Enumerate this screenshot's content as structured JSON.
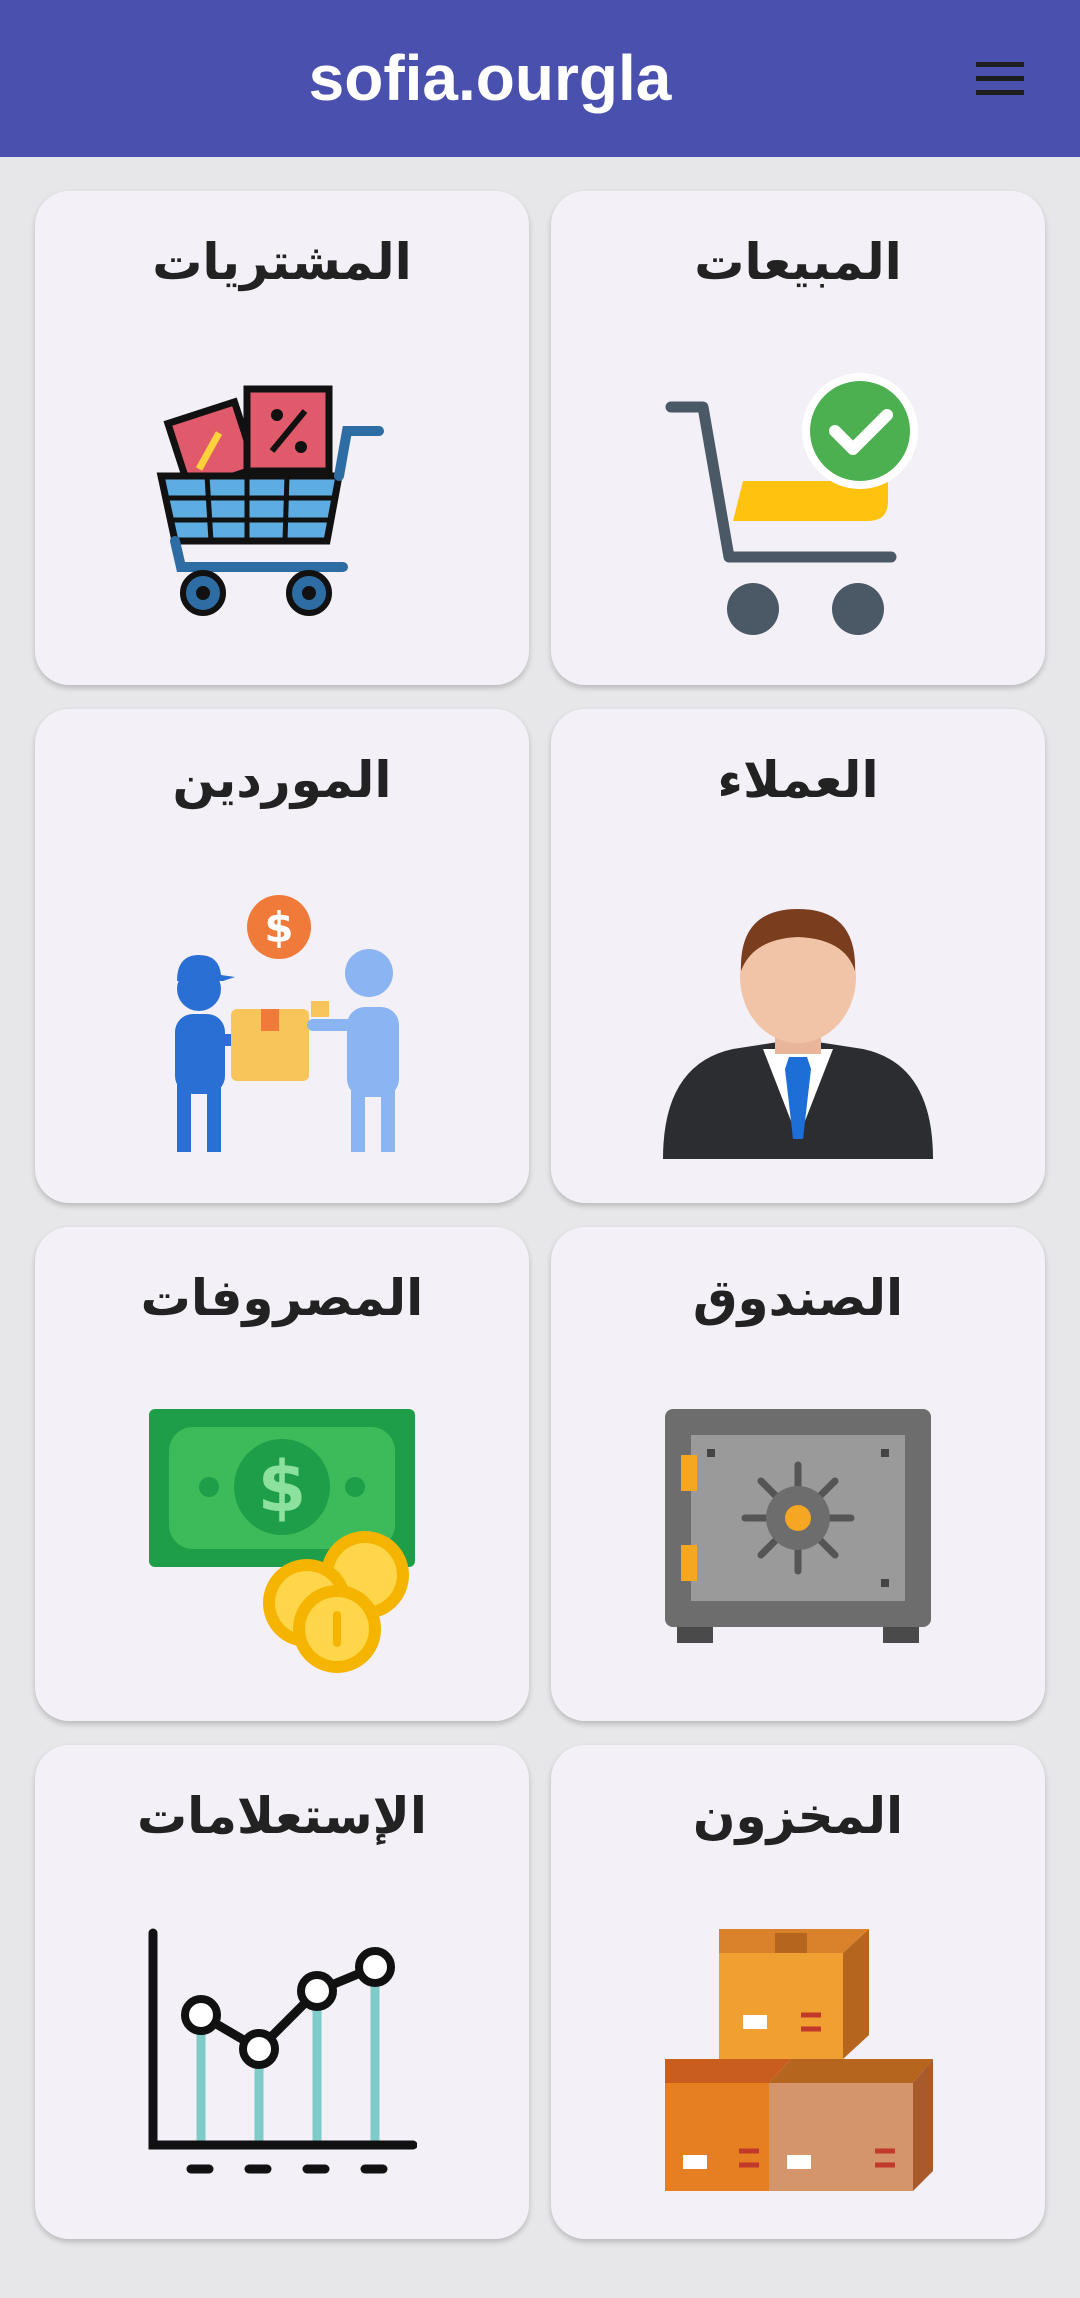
{
  "app": {
    "title": "sofia.ourgla",
    "menu_icon": "hamburger-menu-icon",
    "header_color": "#4a50ad"
  },
  "tiles": [
    {
      "id": "sales",
      "label": "المبيعات",
      "icon": "cart-check-icon"
    },
    {
      "id": "purchases",
      "label": "المشتريات",
      "icon": "shopping-cart-icon"
    },
    {
      "id": "customers",
      "label": "العملاء",
      "icon": "businessman-icon"
    },
    {
      "id": "suppliers",
      "label": "الموردين",
      "icon": "delivery-icon"
    },
    {
      "id": "cashbox",
      "label": "الصندوق",
      "icon": "safe-icon"
    },
    {
      "id": "expenses",
      "label": "المصروفات",
      "icon": "money-icon"
    },
    {
      "id": "inventory",
      "label": "المخزون",
      "icon": "boxes-icon"
    },
    {
      "id": "queries",
      "label": "الإستعلامات",
      "icon": "line-chart-icon"
    }
  ]
}
